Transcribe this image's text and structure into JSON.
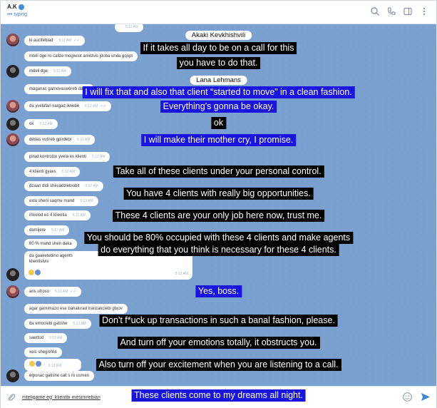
{
  "header": {
    "contact_name": "A.K",
    "status": "typing",
    "icons": [
      "search-icon",
      "phone-icon",
      "sidebar-icon",
      "more-icon"
    ]
  },
  "chat": {
    "messages": [
      {
        "text": "",
        "time": "5:11 AM"
      },
      {
        "text": "ki aucifeblad",
        "time": "5:11 AM"
      },
      {
        "text": "mteli dge ro callze mogiwiot amistvis jdoba unda gqopt",
        "time": ""
      },
      {
        "text": "mdeli dge",
        "time": "5:11 AM"
      },
      {
        "text": "maganac gamovasworeb da eg",
        "time": ""
      },
      {
        "text": "da yvelafari kargad iknebe",
        "time": "5:12 AM"
      },
      {
        "text": "ok",
        "time": "5:12 AM"
      },
      {
        "text": "dedas vutireb gpirdebi",
        "time": "5:12 AM"
      },
      {
        "text": "pirad kontrolze yvela es klienti",
        "time": "5:12 AM"
      },
      {
        "text": "4 klienti gyavs",
        "time": "5:12 AM"
      },
      {
        "text": "dzaan didi shesadzlebiobit",
        "time": "5:12 AM"
      },
      {
        "text": "exla sheni saqme mand",
        "time": "5:12 AM"
      },
      {
        "text": "mxolod es 4 klientia",
        "time": "5:12 AM"
      },
      {
        "text": "damijere",
        "time": "5:12 AM"
      },
      {
        "text": "80 % mand shen daka",
        "time": ""
      },
      {
        "text": "da gaaketebino agents",
        "time": ""
      },
      {
        "text": "klientistvis",
        "time": "5:13 AM"
      },
      {
        "text": "aris ufroso",
        "time": "5:13 AM"
      },
      {
        "text": "agar gamimazo ese banalurad tranzakciebi gtxov",
        "time": ""
      },
      {
        "text": "da emociebi gatishe",
        "time": "5:13 AM"
      },
      {
        "text": "saertod",
        "time": "5:13 AM"
      },
      {
        "text": "xels shegishlis",
        "time": "5:13 AM"
      },
      {
        "text": "",
        "time": "5:13 AM"
      },
      {
        "text": "elporiac gatishe call s ro usmen",
        "time": ""
      }
    ],
    "speakers": [
      "Akaki Kevkhishvili",
      "Lana Lehmans"
    ],
    "subtitles": [
      "If it takes all day to be on a call for this",
      "you have to do that.",
      "I will fix that and also that client “started to move” in a clean fashion.",
      "Everything's gonna be okay.",
      "ok",
      "I will make their mother cry, I promise.",
      "Take all of these clients under your personal control.",
      "You have 4 clients with really big opportunities.",
      "These 4 clients are your only job here now, trust me.",
      "You should be 80% occupied with these 4 clients and make agents",
      "do everything that you think is necessary for these 4 clients.",
      "Yes, boss.",
      "Don't f*uck up transactions in such a banal fashion, please.",
      "And turn off your emotions totally, it obstructs you.",
      "Also turn off your excitement when you are listening to a call.",
      "These clients come to my dreams all night."
    ]
  },
  "footer": {
    "input_value": "mteligame eg  klientbi mesimrebian"
  },
  "colors": {
    "chat_bg": "#7aa0cf",
    "subtitle_blue": "#1a14e0",
    "subtitle_black": "#000000",
    "accent": "#3d86d6"
  }
}
